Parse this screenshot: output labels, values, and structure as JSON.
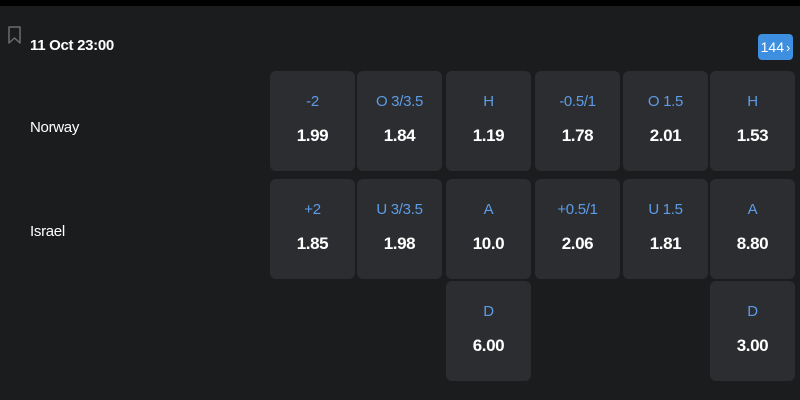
{
  "match": {
    "kickoff": "11 Oct 23:00",
    "more_count": "144",
    "home_team": "Norway",
    "away_team": "Israel"
  },
  "odds": {
    "home": [
      {
        "label": "-2",
        "value": "1.99"
      },
      {
        "label": "O 3/3.5",
        "value": "1.84"
      },
      {
        "label": "H",
        "value": "1.19"
      },
      {
        "label": "-0.5/1",
        "value": "1.78"
      },
      {
        "label": "O 1.5",
        "value": "2.01"
      },
      {
        "label": "H",
        "value": "1.53"
      }
    ],
    "away": [
      {
        "label": "+2",
        "value": "1.85"
      },
      {
        "label": "U 3/3.5",
        "value": "1.98"
      },
      {
        "label": "A",
        "value": "10.0"
      },
      {
        "label": "+0.5/1",
        "value": "2.06"
      },
      {
        "label": "U 1.5",
        "value": "1.81"
      },
      {
        "label": "A",
        "value": "8.80"
      }
    ],
    "draw": [
      {
        "label": "D",
        "value": "6.00"
      },
      {
        "label": "D",
        "value": "3.00"
      }
    ]
  },
  "icons": {
    "bookmark": "bookmark-icon",
    "more": "chevron-right-icon"
  },
  "colors": {
    "background": "#1b1c1e",
    "odd_cell": "#2c2d30",
    "label": "#5d9ce6",
    "accent": "#3f8fe0",
    "text": "#ffffff"
  }
}
